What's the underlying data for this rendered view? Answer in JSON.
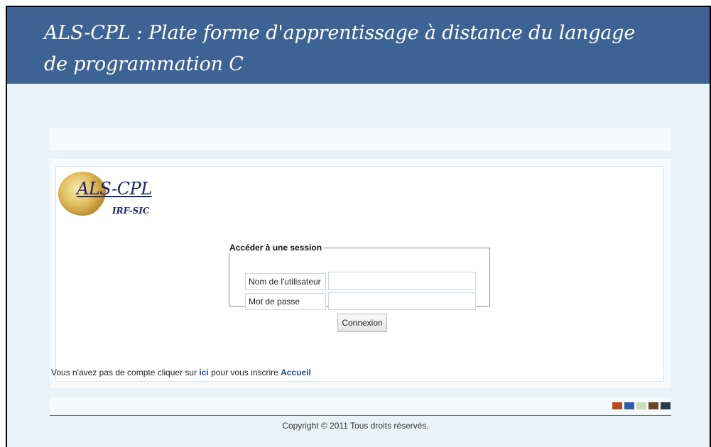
{
  "header": {
    "title": "ALS-CPL : Plate forme d'apprentissage à distance du langage de programmation C"
  },
  "logo": {
    "main_text": "ALS-CPL",
    "sub_text": "IRF-SIC"
  },
  "login": {
    "legend": "Accéder à une session",
    "username_label": "Nom de l'utilisateur",
    "username_value": "",
    "password_label": "Mot de passe",
    "password_value": "",
    "submit_label": "Connexion"
  },
  "register": {
    "prefix": "Vous n'avez pas de compte cliquer sur ",
    "link_label": "ici",
    "middle": " pour vous inscrire ",
    "home_link_label": "Accueil"
  },
  "footer": {
    "copyright": "Copyright © 2011 Tous droits réservés.",
    "swatch_colors": [
      "#b84a1f",
      "#2c5da8",
      "#c6dfb2",
      "#6b4426",
      "#2b3a46"
    ]
  },
  "colors": {
    "header_bg": "#3d6394",
    "page_bg": "#eaf2f9",
    "link": "#1f4f8f"
  }
}
